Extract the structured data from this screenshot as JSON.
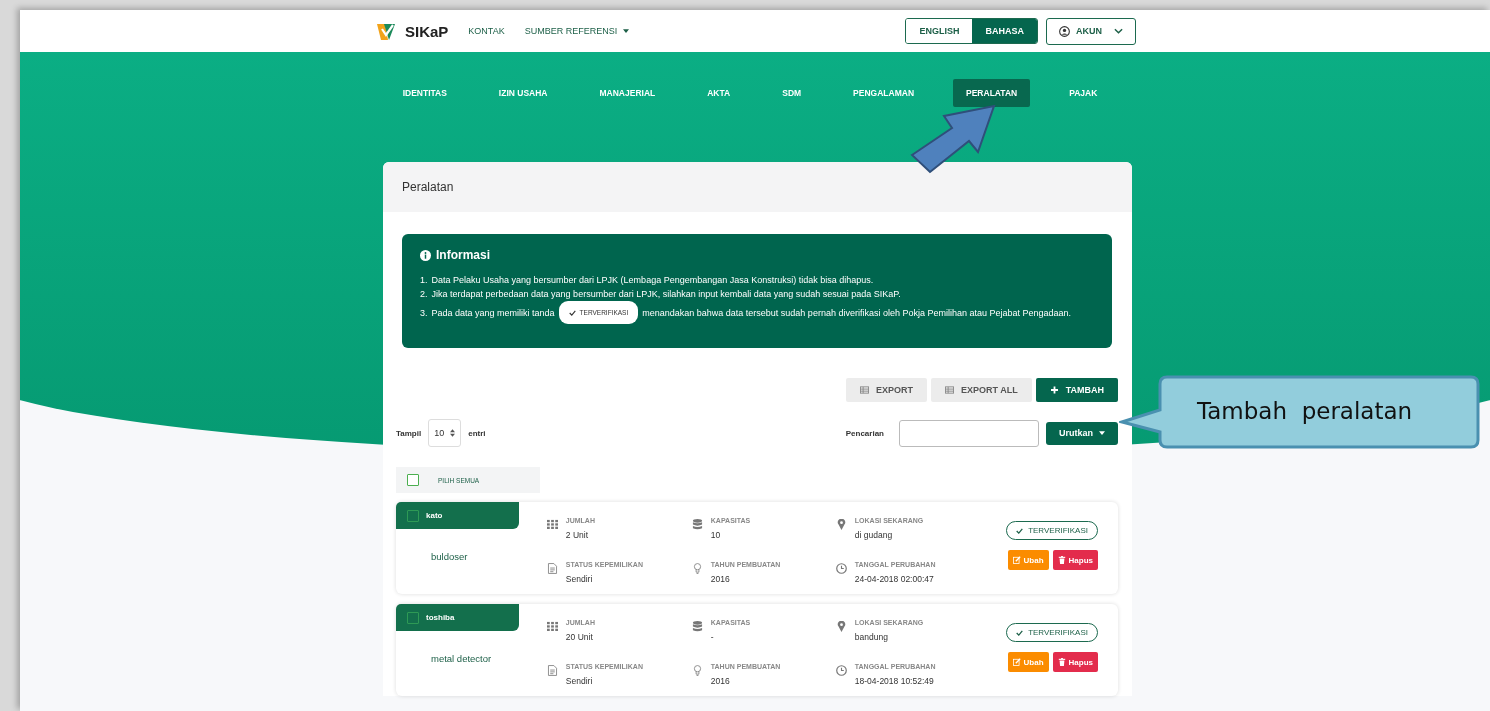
{
  "header": {
    "logo_text": "SIKaP",
    "links": [
      {
        "label": "KONTAK",
        "dropdown": false
      },
      {
        "label": "SUMBER REFERENSI",
        "dropdown": true
      }
    ],
    "languages": [
      {
        "label": "ENGLISH",
        "selected": false
      },
      {
        "label": "BAHASA",
        "selected": true
      }
    ],
    "account": "AKUN"
  },
  "tabs": [
    {
      "label": "IDENTITAS",
      "selected": false
    },
    {
      "label": "IZIN USAHA",
      "selected": false
    },
    {
      "label": "MANAJERIAL",
      "selected": false
    },
    {
      "label": "AKTA",
      "selected": false
    },
    {
      "label": "SDM",
      "selected": false
    },
    {
      "label": "PENGALAMAN",
      "selected": false
    },
    {
      "label": "PERALATAN",
      "selected": true
    },
    {
      "label": "PAJAK",
      "selected": false
    }
  ],
  "panel": {
    "title": "Peralatan",
    "info": {
      "title": "Informasi",
      "items": [
        {
          "number": "1.",
          "text": "Data Pelaku Usaha yang bersumber dari LPJK (Lembaga Pengembangan Jasa Konstruksi) tidak bisa dihapus."
        },
        {
          "number": "2.",
          "text": "Jika terdapat perbedaan data yang bersumber dari LPJK, silahkan input kembali data yang sudah sesuai pada SIKaP."
        },
        {
          "number": "3.",
          "text": "Pada data yang memiliki tanda",
          "badge": "TERVERIFIKASI",
          "text_after": "menandakan bahwa data tersebut sudah pernah diverifikasi oleh Pokja Pemilihan atau Pejabat Pengadaan."
        }
      ]
    },
    "toolbar": [
      {
        "label": "EXPORT",
        "kind": "export"
      },
      {
        "label": "EXPORT ALL",
        "kind": "export"
      },
      {
        "label": "TAMBAH",
        "kind": "add"
      }
    ],
    "length": {
      "label": "Tampil",
      "value": "10",
      "suffix": "entri"
    },
    "search": {
      "label": "Pencarian"
    },
    "sort": "Urutkan",
    "select_all": {
      "label": "PILIH SEMUA",
      "checked": false
    },
    "items": [
      {
        "brand": "kato",
        "checked": false,
        "name": "buldoser",
        "status": "TERVERIFIKASI",
        "actions": [
          {
            "label": "Ubah",
            "kind": "edit"
          },
          {
            "label": "Hapus",
            "kind": "delete"
          }
        ],
        "fields": [
          {
            "kind": "grid",
            "label": "JUMLAH",
            "value": "2 Unit"
          },
          {
            "kind": "database",
            "label": "KAPASITAS",
            "value": "10"
          },
          {
            "kind": "pin",
            "label": "LOKASI SEKARANG",
            "value": "di gudang"
          },
          {
            "kind": "document",
            "label": "STATUS KEPEMILIKAN",
            "value": "Sendiri"
          },
          {
            "kind": "bulb",
            "label": "TAHUN PEMBUATAN",
            "value": "2016"
          },
          {
            "kind": "clock",
            "label": "TANGGAL PERUBAHAN",
            "value": "24-04-2018 02:00:47"
          }
        ]
      },
      {
        "brand": "toshiba",
        "checked": false,
        "name": "metal detector",
        "status": "TERVERIFIKASI",
        "actions": [
          {
            "label": "Ubah",
            "kind": "edit"
          },
          {
            "label": "Hapus",
            "kind": "delete"
          }
        ],
        "fields": [
          {
            "kind": "grid",
            "label": "JUMLAH",
            "value": "20 Unit"
          },
          {
            "kind": "database",
            "label": "KAPASITAS",
            "value": "-"
          },
          {
            "kind": "pin",
            "label": "LOKASI SEKARANG",
            "value": "bandung"
          },
          {
            "kind": "document",
            "label": "STATUS KEPEMILIKAN",
            "value": "Sendiri"
          },
          {
            "kind": "bulb",
            "label": "TAHUN PEMBUATAN",
            "value": "2016"
          },
          {
            "kind": "clock",
            "label": "TANGGAL PERUBAHAN",
            "value": "18-04-2018 10:52:49"
          }
        ]
      }
    ]
  },
  "callout": {
    "text": "Tambah  peralatan"
  }
}
